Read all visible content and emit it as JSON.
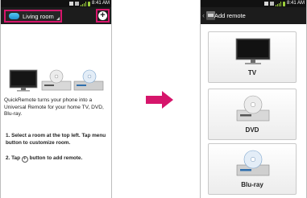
{
  "left_screen": {
    "status_time": "8:41 AM",
    "room_selector_label": "Living room",
    "add_button_glyph": "+",
    "intro_text": "QuickRemote turns your phone into a Universal Remote for your home TV, DVD, Blu-ray.",
    "step1": "1. Select a room at the top left. Tap menu button to customize room.",
    "step2_prefix": "2. Tap",
    "step2_icon_glyph": "+",
    "step2_suffix": "button to add remote.",
    "icons": [
      "tv-icon",
      "dvd-player-icon",
      "blu-ray-player-icon",
      "add-circle-icon"
    ]
  },
  "right_screen": {
    "status_time": "8:41 AM",
    "back_glyph": "‹",
    "title": "Add remote",
    "cards": [
      {
        "label": "TV",
        "icon": "tv-icon"
      },
      {
        "label": "DVD",
        "icon": "dvd-player-icon"
      },
      {
        "label": "Blu-ray",
        "icon": "blu-ray-player-icon"
      }
    ]
  },
  "colors": {
    "highlight": "#d6156b",
    "action_bar": "#1c1c1c",
    "room_icon": "#1e8fcf"
  }
}
